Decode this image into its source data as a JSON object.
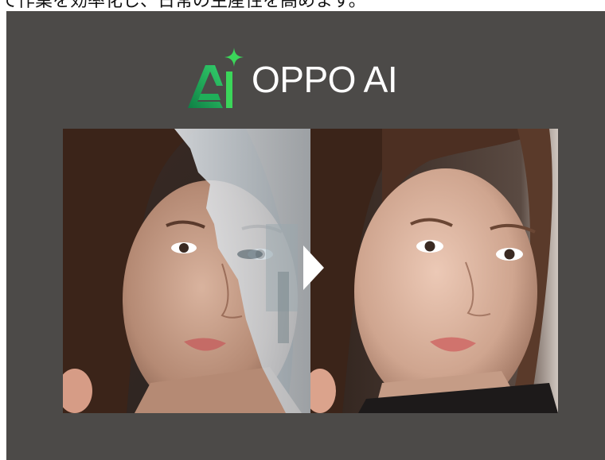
{
  "caption": "で作業を効率化し、日常の生産性を高めます。",
  "logo": {
    "text": "OPPO AI",
    "icon": "oppo-ai-logo-icon",
    "colors": {
      "green_light": "#3bd65a",
      "green_dark": "#0f8e4a"
    }
  },
  "comparison": {
    "before": "before-photo",
    "after": "after-photo",
    "arrow_icon": "arrow-right-icon"
  },
  "colors": {
    "panel": "#4c4a48",
    "background": "#ffffff"
  }
}
